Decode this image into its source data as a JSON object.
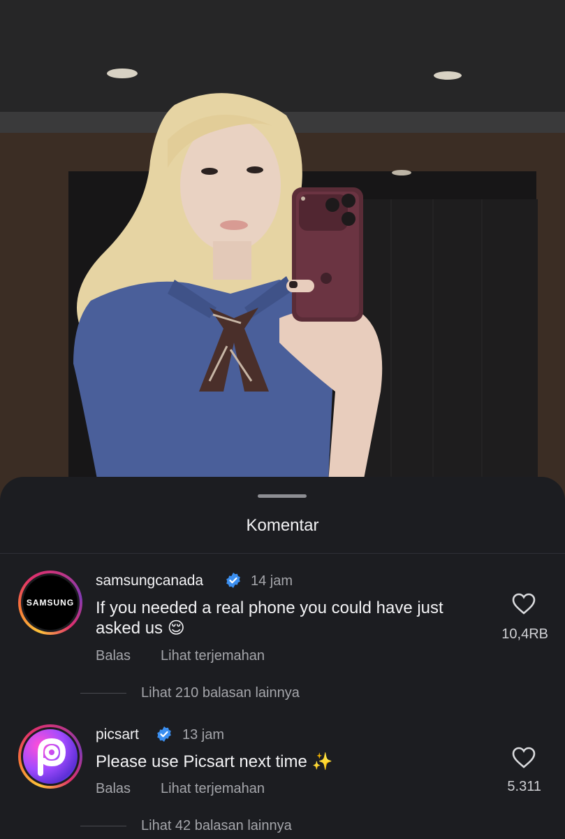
{
  "sheet": {
    "title": "Komentar"
  },
  "comments": [
    {
      "username": "samsungcanada",
      "avatar_text": "SAMSUNG",
      "verified": true,
      "time": "14 jam",
      "text": "If you needed a real phone you could have just asked us 😌",
      "reply_label": "Balas",
      "translate_label": "Lihat terjemahan",
      "likes": "10,4RB",
      "more_replies": "Lihat 210 balasan lainnya"
    },
    {
      "username": "picsart",
      "avatar_text": "",
      "verified": true,
      "time": "13 jam",
      "text": "Please use Picsart next time ✨",
      "reply_label": "Balas",
      "translate_label": "Lihat terjemahan",
      "likes": "5.311",
      "more_replies": "Lihat 42 balasan lainnya"
    }
  ],
  "icons": {
    "verified": "verified-badge-icon",
    "like": "heart-icon"
  },
  "colors": {
    "sheet_bg": "#1c1d21",
    "verified_blue": "#3b8ff0",
    "secondary_text": "#a5a6ab"
  }
}
